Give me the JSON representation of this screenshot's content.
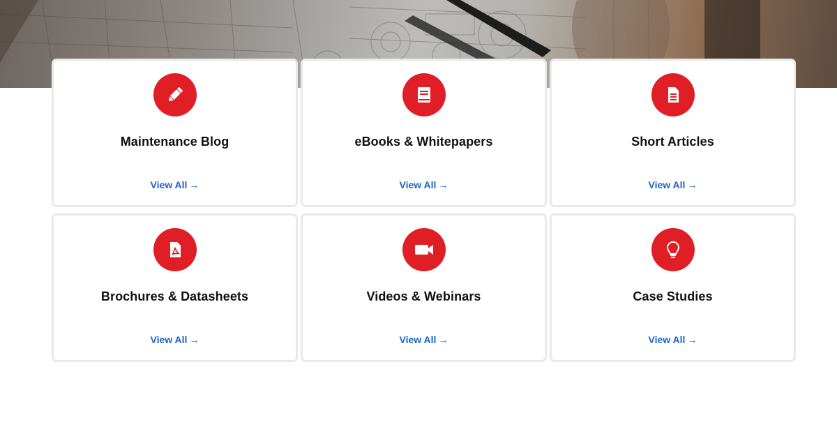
{
  "theme": {
    "accent": "#e01e26",
    "link_color": "#1c64c8"
  },
  "hero": {
    "image": "blueprint-drawings-photo"
  },
  "cards": [
    {
      "title": "Maintenance Blog",
      "icon": "pencil-icon",
      "link_label": "View All",
      "link_arrow": "→"
    },
    {
      "title": "eBooks & Whitepapers",
      "icon": "book-icon",
      "link_label": "View All",
      "link_arrow": "→"
    },
    {
      "title": "Short Articles",
      "icon": "document-icon",
      "link_label": "View All",
      "link_arrow": "→"
    },
    {
      "title": "Brochures & Datasheets",
      "icon": "pdf-file-icon",
      "link_label": "View All",
      "link_arrow": "→"
    },
    {
      "title": "Videos & Webinars",
      "icon": "video-camera-icon",
      "link_label": "View All",
      "link_arrow": "→"
    },
    {
      "title": "Case Studies",
      "icon": "lightbulb-icon",
      "link_label": "View All",
      "link_arrow": "→"
    }
  ]
}
